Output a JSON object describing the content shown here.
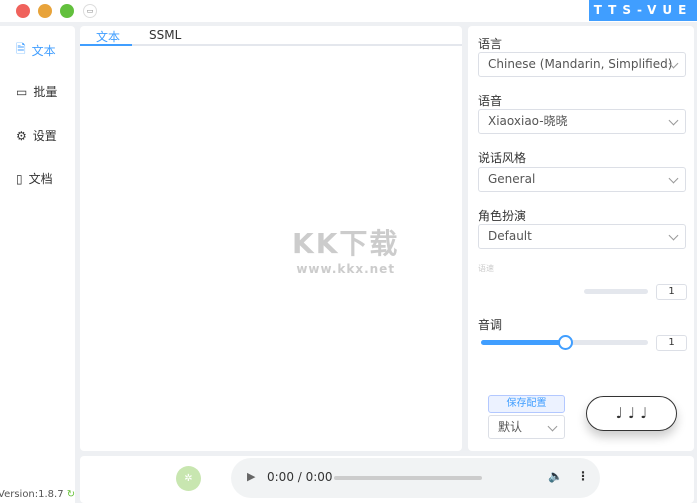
{
  "window": {
    "brand": "TTS-VUE"
  },
  "sidebar": {
    "items": [
      {
        "label": "文本",
        "icon": "document-icon",
        "active": true
      },
      {
        "label": "批量",
        "icon": "box-icon"
      },
      {
        "label": "设置",
        "icon": "gear-icon"
      },
      {
        "label": "文档",
        "icon": "book-icon"
      }
    ],
    "version": "Version:1.8.7"
  },
  "editor": {
    "tabs": [
      "文本",
      "SSML"
    ],
    "watermark": {
      "logo": "KK下载",
      "url": "www.kkx.net"
    }
  },
  "config": {
    "language": {
      "label": "语言",
      "value": "Chinese (Mandarin, Simplified)"
    },
    "voice": {
      "label": "语音",
      "value": "Xiaoxiao-晓晓"
    },
    "style": {
      "label": "说话风格",
      "value": "General"
    },
    "role": {
      "label": "角色扮演",
      "value": "Default"
    },
    "rate": {
      "label": "语速",
      "value": "1"
    },
    "pitch": {
      "label": "音调",
      "value": "1",
      "fraction": 0.5
    },
    "save_label": "保存配置",
    "preset": "默认",
    "play_label": "♩ ♩ ♩"
  },
  "player": {
    "time": "0:00 / 0:00"
  },
  "colors": {
    "accent": "#409eff"
  }
}
